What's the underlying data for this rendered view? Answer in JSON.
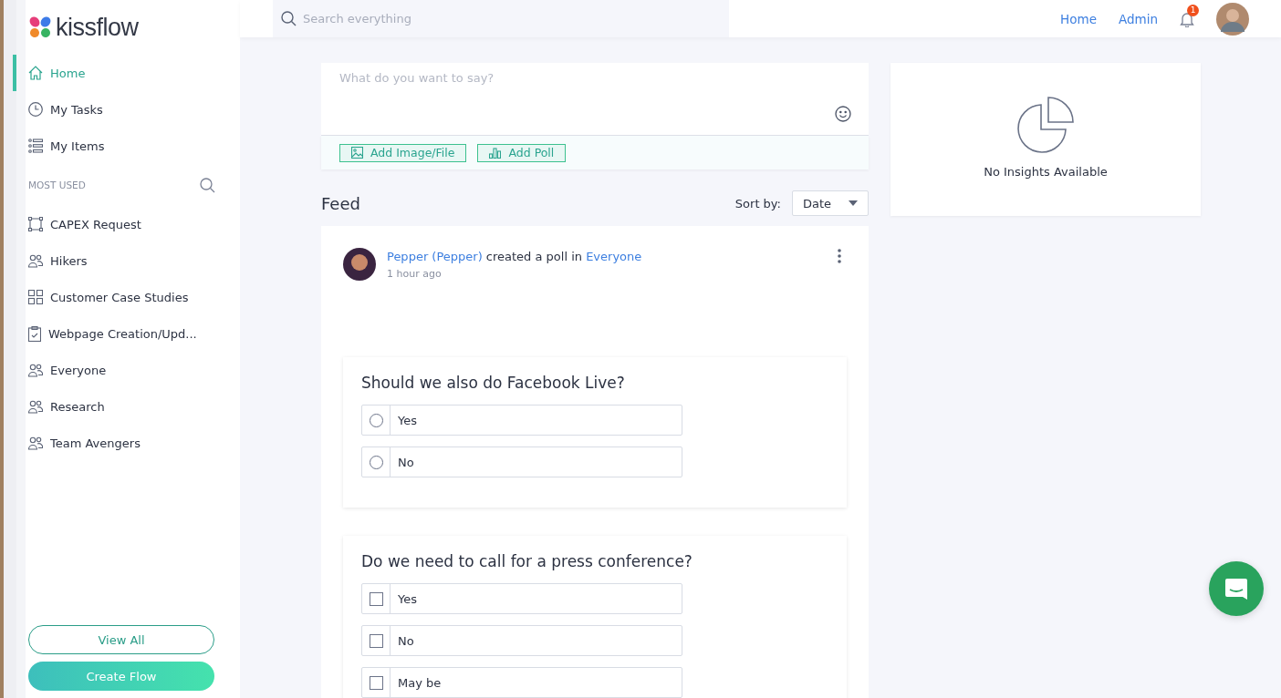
{
  "logo": {
    "text": "kissflow"
  },
  "nav": [
    {
      "label": "Home",
      "kind": "home",
      "selected": true
    },
    {
      "label": "My Tasks",
      "kind": "tasks",
      "selected": false
    },
    {
      "label": "My Items",
      "kind": "items",
      "selected": false
    }
  ],
  "most_used": {
    "heading": "MOST USED",
    "items": [
      {
        "label": "CAPEX Request",
        "kind": "flow"
      },
      {
        "label": "Hikers",
        "kind": "group"
      },
      {
        "label": "Customer Case Studies",
        "kind": "board"
      },
      {
        "label": "Webpage Creation/Upd...",
        "kind": "form"
      },
      {
        "label": "Everyone",
        "kind": "group"
      },
      {
        "label": "Research",
        "kind": "group"
      },
      {
        "label": "Team Avengers",
        "kind": "group"
      }
    ]
  },
  "sidebar_buttons": [
    "View All",
    "Create Flow"
  ],
  "top_bar": {
    "search": {
      "placeholder": "Search everything"
    },
    "links": [
      "Home",
      "Admin"
    ],
    "notification_count": "1"
  },
  "composer": {
    "placeholder": "What do you want to say?",
    "actions": [
      "Add Image/File",
      "Add Poll"
    ]
  },
  "feed": {
    "title": "Feed",
    "sort_label": "Sort by:",
    "sort_value": "Date"
  },
  "post": {
    "author": "Pepper (Pepper)",
    "action": "created a poll in",
    "target": "Everyone",
    "time": "1 hour ago",
    "polls": [
      {
        "question": "Should we also do Facebook Live?",
        "kind": "single",
        "options": [
          {
            "label": "Yes",
            "selected": false
          },
          {
            "label": "No",
            "selected": false
          }
        ]
      },
      {
        "question": "Do we need to call for a press conference?",
        "kind": "multiple",
        "options": [
          {
            "label": "Yes",
            "selected": false
          },
          {
            "label": "No",
            "selected": false
          },
          {
            "label": "May be",
            "selected": false
          }
        ]
      }
    ]
  },
  "insights": {
    "message": "No Insights Available"
  }
}
